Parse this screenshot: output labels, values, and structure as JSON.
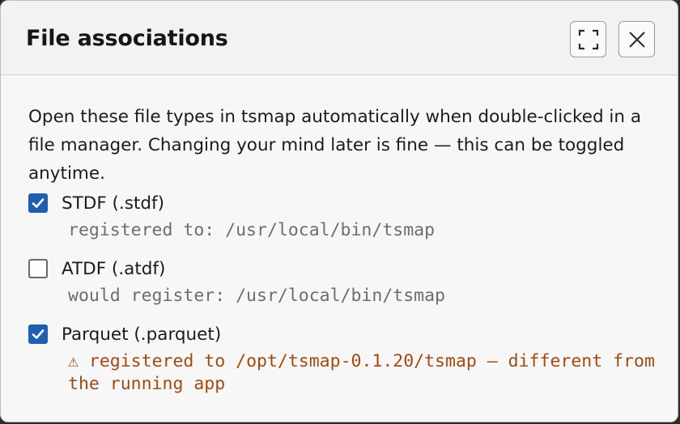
{
  "dialog": {
    "title": "File associations",
    "description": "Open these file types in tsmap automatically when double-clicked in a file manager. Changing your mind later is fine — this can be toggled anytime.",
    "maximize_icon": "fullscreen-icon",
    "close_icon": "close-icon"
  },
  "options": [
    {
      "label": "STDF (.stdf)",
      "checked": true,
      "detail": "registered to: /usr/local/bin/tsmap"
    },
    {
      "label": "ATDF (.atdf)",
      "checked": false,
      "detail": "would register: /usr/local/bin/tsmap"
    },
    {
      "label": "Parquet (.parquet)",
      "checked": true,
      "warning_icon": "⚠",
      "detail": "registered to /opt/tsmap-0.1.20/tsmap — different from the running app"
    }
  ],
  "colors": {
    "accent": "#1e5fb4",
    "warning": "#a24a10"
  }
}
